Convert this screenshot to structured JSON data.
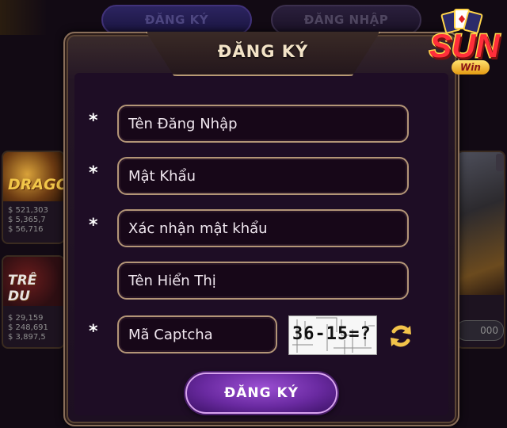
{
  "background": {
    "tabs": {
      "register": "ĐĂNG KÝ",
      "login": "ĐĂNG NHẬP"
    },
    "games": [
      {
        "title": "DRAGO",
        "jackpots": [
          "521,303",
          "5,365,7",
          "56,716"
        ]
      },
      {
        "title": "TRÊ DU",
        "jackpots": [
          "29,159",
          "248,691",
          "3,897,5"
        ]
      }
    ],
    "side_badge": "000"
  },
  "modal": {
    "title": "ĐĂNG KÝ",
    "fields": {
      "username": {
        "placeholder": "Tên Đăng Nhập",
        "required_mark": "*"
      },
      "password": {
        "placeholder": "Mật Khẩu",
        "required_mark": "*"
      },
      "confirm_password": {
        "placeholder": "Xác nhận mật khẩu",
        "required_mark": "*"
      },
      "display_name": {
        "placeholder": "Tên Hiển Thị"
      },
      "captcha": {
        "placeholder": "Mã Captcha",
        "required_mark": "*"
      }
    },
    "captcha_image_text": "36-15=?",
    "refresh_icon": "refresh-icon",
    "submit_label": "ĐĂNG KÝ"
  },
  "logo": {
    "brand": "SUN",
    "sub": "Win",
    "icon": "card-suit-icon"
  },
  "colors": {
    "field_border": "#b39577",
    "button_purple": "#6a2aa1",
    "title_text": "#f3e3c7",
    "panel_bg": "#1e0d25"
  }
}
